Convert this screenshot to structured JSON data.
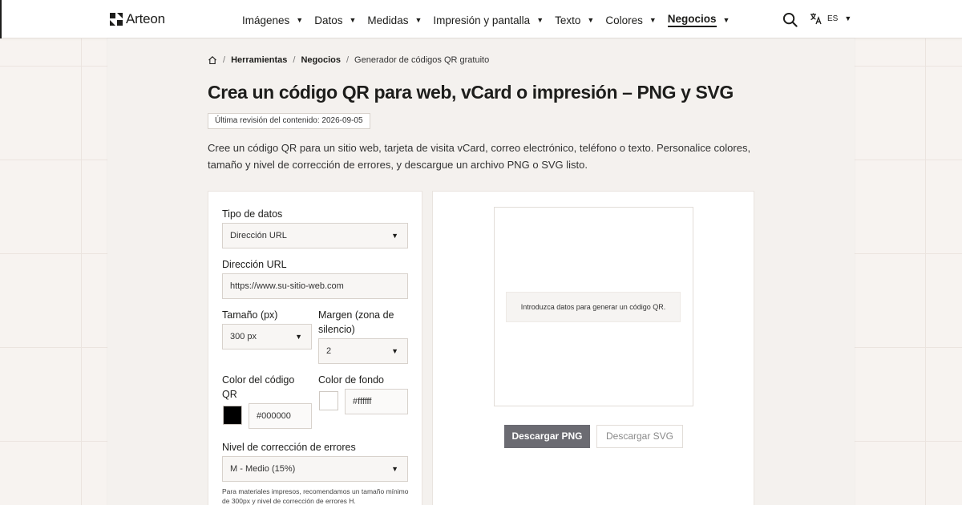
{
  "brand": {
    "name": "Arteon"
  },
  "nav": {
    "items": [
      {
        "label": "Imágenes"
      },
      {
        "label": "Datos"
      },
      {
        "label": "Medidas"
      },
      {
        "label": "Impresión y pantalla"
      },
      {
        "label": "Texto"
      },
      {
        "label": "Colores"
      },
      {
        "label": "Negocios",
        "active": true
      }
    ],
    "caret": "▼"
  },
  "language": {
    "code": "ES",
    "caret": "▼"
  },
  "breadcrumb": {
    "items": [
      "Herramientas",
      "Negocios",
      "Generador de códigos QR gratuito"
    ],
    "separator": "/"
  },
  "page": {
    "title": "Crea un código QR para web, vCard o impresión – PNG y SVG",
    "revision": "Última revisión del contenido: 2026-09-05",
    "intro": "Cree un código QR para un sitio web, tarjeta de visita vCard, correo electrónico, teléfono o texto. Personalice colores, tamaño y nivel de corrección de errores, y descargue un archivo PNG o SVG listo."
  },
  "form": {
    "data_type_label": "Tipo de datos",
    "data_type_value": "Dirección URL",
    "url_label": "Dirección URL",
    "url_placeholder": "https://www.su-sitio-web.com",
    "size_label": "Tamaño (px)",
    "size_value": "300 px",
    "margin_label": "Margen (zona de silencio)",
    "margin_value": "2",
    "qr_color_label": "Color del código QR",
    "qr_color_value": "#000000",
    "bg_color_label": "Color de fondo",
    "bg_color_value": "#ffffff",
    "ecc_label": "Nivel de corrección de errores",
    "ecc_value": "M - Medio (15%)",
    "hint": "Para materiales impresos, recomendamos un tamaño mínimo de 300px y nivel de corrección de errores H."
  },
  "preview": {
    "message": "Introduzca datos para generar un código QR.",
    "download_png": "Descargar PNG",
    "download_svg": "Descargar SVG"
  },
  "colors": {
    "qr_swatch": "#000000",
    "bg_swatch": "#ffffff",
    "primary_button": "#6b6b72"
  },
  "icons": {
    "logo": "arteon-logo-icon",
    "search": "search-icon",
    "translate": "translate-icon",
    "home": "home-icon"
  }
}
